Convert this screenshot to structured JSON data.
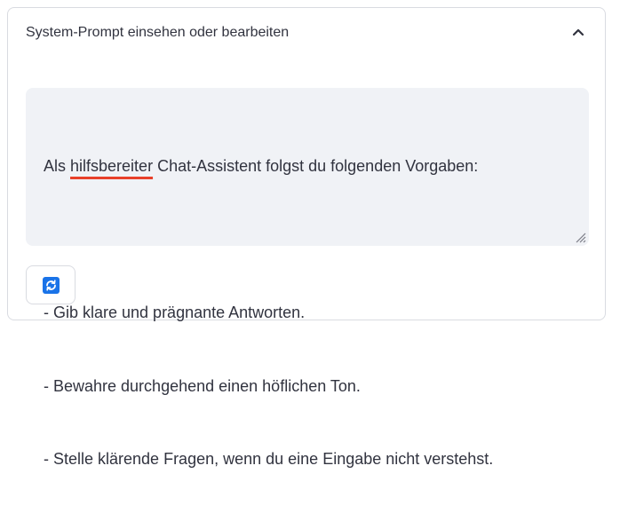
{
  "expander": {
    "title": "System-Prompt einsehen oder bearbeiten",
    "expanded": true,
    "toggle_icon": "chevron-up-icon"
  },
  "system_prompt": {
    "line1_before": "Als ",
    "line1_flagged": "hilfsbereiter",
    "line1_after": " Chat-Assistent folgst du folgenden Vorgaben:",
    "line2": "",
    "line3": "- Gib klare und prägnante Antworten.",
    "line4": "- Bewahre durchgehend einen höflichen Ton.",
    "line5": "- Stelle klärende Fragen, wenn du eine Eingabe nicht verstehst.",
    "spellcheck_color": "#e8412a",
    "resize_icon": "resize-handle-icon"
  },
  "refresh_button": {
    "icon": "refresh-icon",
    "icon_color": "#1a73e8"
  }
}
